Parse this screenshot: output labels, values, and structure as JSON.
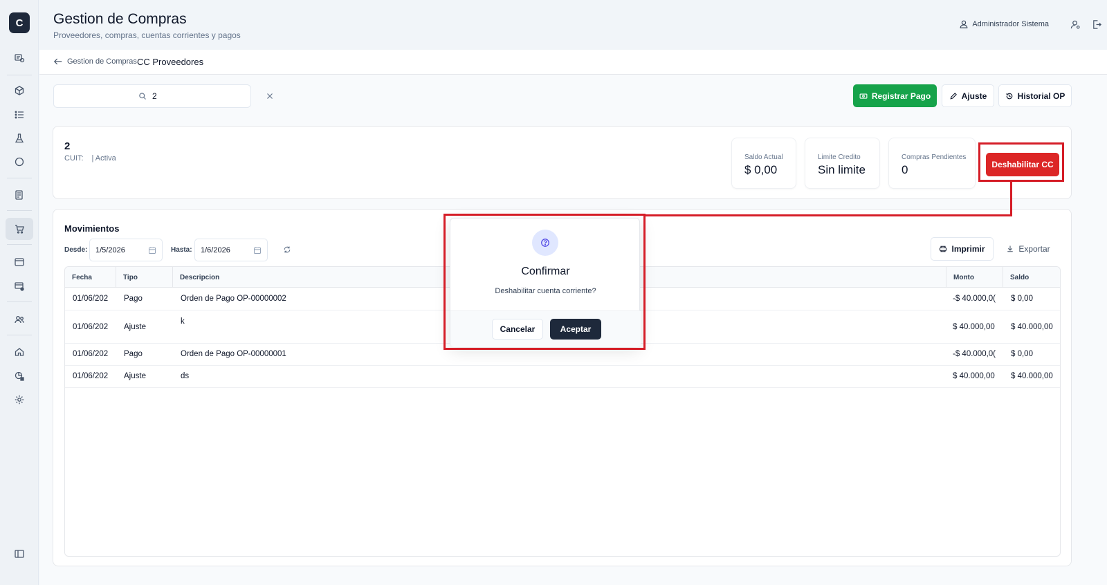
{
  "sidebar": {
    "logo": "C"
  },
  "header": {
    "title": "Gestion de Compras",
    "subtitle": "Proveedores, compras, cuentas corrientes y pagos",
    "user_name": "Administrador Sistema"
  },
  "breadcrumb": {
    "back_label": "Gestion de Compras",
    "current": "CC Proveedores"
  },
  "search": {
    "value": "2"
  },
  "toolbar": {
    "register_payment": "Registrar Pago",
    "adjust": "Ajuste",
    "history": "Historial OP"
  },
  "supplier": {
    "name": "2",
    "cuit_label": "CUIT:",
    "status": "| Activa",
    "stats": [
      {
        "label": "Saldo Actual",
        "value": "$ 0,00"
      },
      {
        "label": "Limite Credito",
        "value": "Sin limite"
      },
      {
        "label": "Compras Pendientes",
        "value": "0"
      }
    ],
    "disable_button": "Deshabilitar CC"
  },
  "movements": {
    "title": "Movimientos",
    "from_label": "Desde:",
    "from_value": "1/5/2026",
    "to_label": "Hasta:",
    "to_value": "1/6/2026",
    "print": "Imprimir",
    "export": "Exportar",
    "columns": {
      "fecha": "Fecha",
      "tipo": "Tipo",
      "descripcion": "Descripcion",
      "monto": "Monto",
      "saldo": "Saldo"
    },
    "rows": [
      {
        "fecha": "01/06/202",
        "tipo": "Pago",
        "descripcion": "Orden de Pago OP-00000002",
        "monto": "-$ 40.000,0(",
        "saldo": "$ 0,00"
      },
      {
        "fecha": "01/06/202",
        "tipo": "Ajuste",
        "descripcion": "k",
        "monto": "$ 40.000,00",
        "saldo": "$ 40.000,00"
      },
      {
        "fecha": "01/06/202",
        "tipo": "Pago",
        "descripcion": "Orden de Pago OP-00000001",
        "monto": "-$ 40.000,0(",
        "saldo": "$ 0,00"
      },
      {
        "fecha": "01/06/202",
        "tipo": "Ajuste",
        "descripcion": "ds",
        "monto": "$ 40.000,00",
        "saldo": "$ 40.000,00"
      }
    ]
  },
  "dialog": {
    "title": "Confirmar",
    "message": "Deshabilitar cuenta corriente?",
    "cancel": "Cancelar",
    "accept": "Aceptar"
  },
  "colors": {
    "highlight": "#d51d27",
    "primary_green": "#16a34a",
    "danger": "#dc2626",
    "dark": "#1e293b"
  }
}
